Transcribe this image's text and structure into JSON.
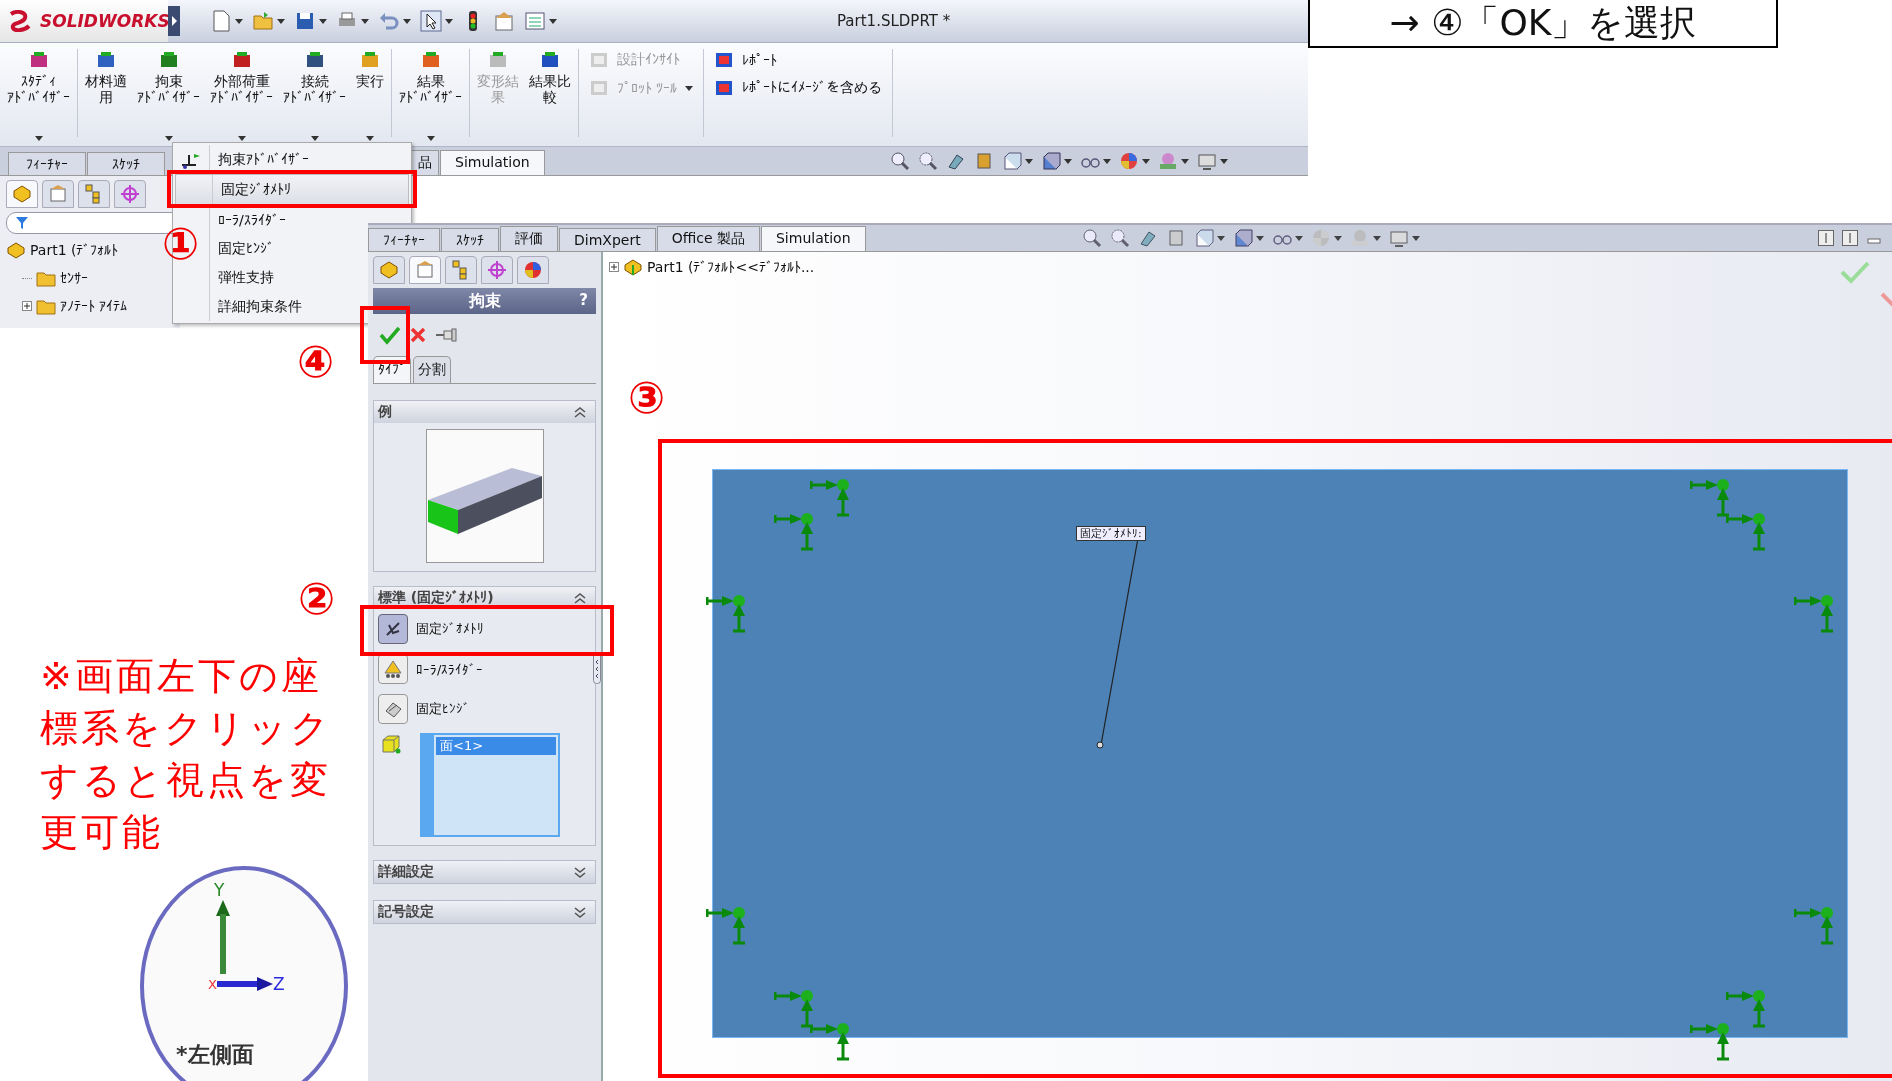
{
  "instruction": {
    "text": "→ ④「OK」を選択"
  },
  "window_a": {
    "logo": "SOLIDWORKS",
    "title": "Part1.SLDPRT *",
    "ribbon": [
      {
        "kind": "large",
        "lines": [
          "ｽﾀﾃﾞｨ",
          "ｱﾄﾞﾊﾞｲｻﾞｰ"
        ],
        "dropdown": true,
        "disabled": false
      },
      {
        "kind": "large",
        "lines": [
          "材料適",
          "用"
        ],
        "dropdown": false,
        "disabled": false
      },
      {
        "kind": "large",
        "lines": [
          "拘束",
          "ｱﾄﾞﾊﾞｲｻﾞｰ"
        ],
        "dropdown": true,
        "disabled": false
      },
      {
        "kind": "large",
        "lines": [
          "外部荷重",
          "ｱﾄﾞﾊﾞｲｻﾞｰ"
        ],
        "dropdown": true,
        "disabled": false
      },
      {
        "kind": "large",
        "lines": [
          "接続",
          "ｱﾄﾞﾊﾞｲｻﾞｰ"
        ],
        "dropdown": true,
        "disabled": false
      },
      {
        "kind": "large",
        "lines": [
          "実行"
        ],
        "dropdown": true,
        "disabled": false
      },
      {
        "kind": "large",
        "lines": [
          "結果",
          "ｱﾄﾞﾊﾞｲｻﾞｰ"
        ],
        "dropdown": true,
        "disabled": false
      },
      {
        "kind": "large",
        "lines": [
          "変形結",
          "果"
        ],
        "dropdown": false,
        "disabled": true
      },
      {
        "kind": "large",
        "lines": [
          "結果比",
          "較"
        ],
        "dropdown": false,
        "disabled": false
      },
      {
        "kind": "stack",
        "items": [
          {
            "label": "設計ｲﾝｻｲﾄ",
            "disabled": true,
            "dropdown": false
          },
          {
            "label": "ﾌﾟﾛｯﾄ ﾂｰﾙ",
            "disabled": true,
            "dropdown": true
          }
        ]
      },
      {
        "kind": "stack",
        "items": [
          {
            "label": "ﾚﾎﾟｰﾄ",
            "disabled": false,
            "dropdown": false
          },
          {
            "label": "ﾚﾎﾟｰﾄにｲﾒｰｼﾞを含める",
            "disabled": false,
            "dropdown": false
          }
        ]
      }
    ],
    "tabs": [
      {
        "label": "ﾌｨｰﾁｬｰ",
        "selected": false,
        "kind": "full"
      },
      {
        "label": "ｽｹｯﾁ",
        "selected": false,
        "kind": "full"
      },
      {
        "label": "品",
        "selected": false,
        "kind": "cut"
      },
      {
        "label": "Simulation",
        "selected": true,
        "kind": "full"
      }
    ],
    "panel_tabs": [
      {
        "selected": true
      },
      {
        "selected": false
      },
      {
        "selected": false
      },
      {
        "selected": false
      }
    ],
    "tree": [
      {
        "label": "Part1 (ﾃﾞﾌｫﾙﾄ",
        "children": [
          {
            "label": "ｾﾝｻｰ"
          },
          {
            "label": "ｱﾉﾃｰﾄ ｱｲﾃﾑ",
            "expanded": false
          }
        ]
      }
    ],
    "menu": [
      {
        "label": "拘束ｱﾄﾞﾊﾞｲｻﾞｰ",
        "selected": false
      },
      {
        "label": "固定ｼﾞｵﾒﾄﾘ",
        "selected": true
      },
      {
        "label": "ﾛｰﾗ/ｽﾗｲﾀﾞｰ",
        "selected": false
      },
      {
        "label": "固定ﾋﾝｼﾞ",
        "selected": false
      },
      {
        "label": "弾性支持",
        "selected": false
      },
      {
        "label": "詳細拘束条件",
        "selected": false
      }
    ]
  },
  "window_b": {
    "tabs": [
      {
        "label": "ﾌｨｰﾁｬｰ",
        "selected": false
      },
      {
        "label": "ｽｹｯﾁ",
        "selected": false
      },
      {
        "label": "評価",
        "selected": false
      },
      {
        "label": "DimXpert",
        "selected": false
      },
      {
        "label": "Office 製品",
        "selected": false
      },
      {
        "label": "Simulation",
        "selected": true
      }
    ],
    "panel": {
      "tabs": [
        {
          "selected": false
        },
        {
          "selected": true
        },
        {
          "selected": false
        },
        {
          "selected": false
        },
        {
          "selected": false
        }
      ],
      "title": "拘束",
      "help": "?",
      "subtabs": [
        {
          "label": "ﾀｲﾌﾟ",
          "selected": true
        },
        {
          "label": "分割",
          "selected": false
        }
      ],
      "sections": [
        {
          "kind": "example",
          "title": "例",
          "expanded": true
        },
        {
          "kind": "types",
          "title": "標準 (固定ｼﾞｵﾒﾄﾘ)",
          "expanded": true,
          "options": [
            {
              "label": "固定ｼﾞｵﾒﾄﾘ",
              "selected": true
            },
            {
              "label": "ﾛｰﾗ/ｽﾗｲﾀﾞｰ",
              "selected": false
            },
            {
              "label": "固定ﾋﾝｼﾞ",
              "selected": false
            }
          ],
          "selection": [
            {
              "label": "面<1>",
              "selected": true
            }
          ]
        },
        {
          "kind": "plain",
          "title": "詳細設定",
          "expanded": false
        },
        {
          "kind": "plain",
          "title": "記号設定",
          "expanded": false
        }
      ]
    },
    "tree": [
      {
        "label": "Part1 (ﾃﾞﾌｫﾙﾄ<<ﾃﾞﾌｫﾙﾄ...",
        "expanded": false
      }
    ],
    "callout": "固定ｼﾞｵﾒﾄﾘ:"
  },
  "annotations": {
    "steps": [
      "①",
      "②",
      "③",
      "④"
    ],
    "note": "※画面左下の座標系をクリックすると視点を変更可能",
    "axes": {
      "y": "Y",
      "z": "Z",
      "x": "X",
      "view": "*左側面"
    }
  }
}
